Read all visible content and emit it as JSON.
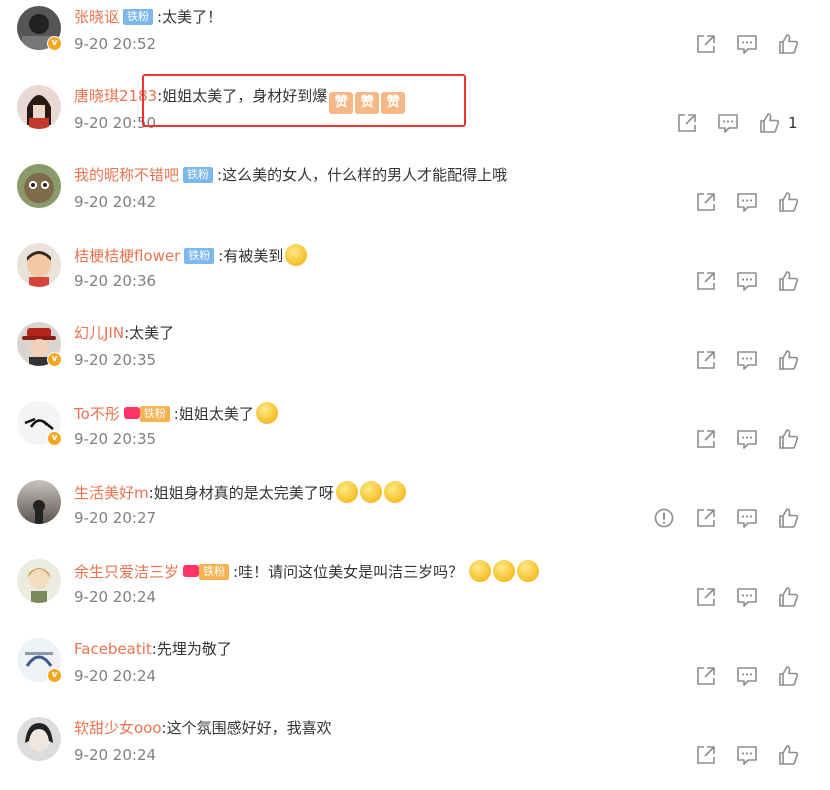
{
  "colors": {
    "username": "#eb7350",
    "text": "#333333",
    "meta": "#808080",
    "badge_blue": "#7cb8ec",
    "highlight_box": "#ee3333"
  },
  "comments": [
    {
      "user": "张晓讴",
      "badge": "铁粉",
      "text": "太美了！",
      "time": "9-20 20:52",
      "verified": true,
      "likes": ""
    },
    {
      "user": "唐晓琪2183",
      "badge": "",
      "text": "姐姐太美了，身材好到爆",
      "emojis": [
        "赞",
        "赞",
        "赞"
      ],
      "time": "9-20 20:50",
      "verified": false,
      "likes": "1"
    },
    {
      "user": "我的昵称不错吧",
      "badge": "铁粉",
      "text": "这么美的女人，什么样的男人才能配得上哦",
      "time": "9-20 20:42",
      "verified": false,
      "likes": ""
    },
    {
      "user": "桔梗桔梗flower",
      "badge": "铁粉",
      "text": "有被美到",
      "time": "9-20 20:36",
      "verified": false,
      "likes": ""
    },
    {
      "user": "幻儿JIN",
      "badge": "",
      "text": "太美了",
      "time": "9-20 20:35",
      "verified": true,
      "likes": ""
    },
    {
      "user": "To不彤",
      "badge": "铁粉",
      "text": "姐姐太美了",
      "time": "9-20 20:35",
      "verified": true,
      "likes": ""
    },
    {
      "user": "生活美好m",
      "badge": "",
      "text": "姐姐身材真的是太完美了呀",
      "time": "9-20 20:27",
      "verified": false,
      "likes": ""
    },
    {
      "user": "余生只爱洁三岁",
      "badge": "铁粉",
      "text": "哇！请问这位美女是叫洁三岁吗？",
      "time": "9-20 20:24",
      "verified": false,
      "likes": ""
    },
    {
      "user": "Facebeatit",
      "badge": "",
      "text": "先埋为敬了",
      "time": "9-20 20:24",
      "verified": true,
      "likes": ""
    },
    {
      "user": "软甜少女ooo",
      "badge": "",
      "text": "这个氛围感好好，我喜欢",
      "time": "9-20 20:24",
      "verified": false,
      "likes": ""
    }
  ],
  "icons": {
    "share": "share-icon",
    "comment": "comment-icon",
    "like": "like-icon",
    "report": "report-icon"
  }
}
